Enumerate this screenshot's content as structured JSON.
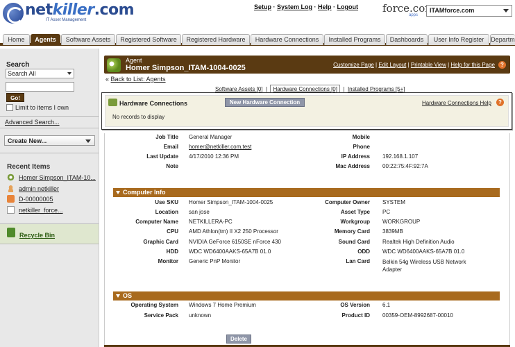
{
  "header": {
    "logo_text_a": "net",
    "logo_text_b": "killer",
    "logo_text_c": ".com",
    "logo_tagline": "IT Asset Management",
    "links": [
      "Setup",
      "System Log",
      "Help",
      "Logout"
    ],
    "force_logo": "force.com",
    "force_apps": "apps",
    "app_selected": "ITAMforce.com"
  },
  "tabs": [
    "Home",
    "Agents",
    "Software Assets",
    "Registered Software",
    "Registered Hardware",
    "Hardware Connections",
    "Installed Programs",
    "Dashboards",
    "User Info Register",
    "Departm"
  ],
  "sidebar": {
    "search_heading": "Search",
    "search_scope": "Search All",
    "search_value": "",
    "go_label": "Go!",
    "limit_label": "Limit to items I own",
    "advanced_label": "Advanced Search...",
    "create_new_label": "Create New...",
    "recent_heading": "Recent Items",
    "recent_items": [
      "Homer Simpson_ITAM-10...",
      "admin netkiller",
      "D-00000005",
      "netkiller_force..."
    ],
    "recycle_label": "Recycle Bin"
  },
  "record": {
    "type_label": "Agent",
    "name": "Homer Simpson_ITAM-1004-0025",
    "header_links": [
      "Customize Page",
      "Edit Layout",
      "Printable View",
      "Help for this Page"
    ],
    "back_link": "Back to List: Agents",
    "subtabs": {
      "software": "Software Assets",
      "software_count": "[0]",
      "hardware": "Hardware Connections",
      "hardware_count": "[0]",
      "installed": "Installed Programs",
      "installed_count": "[5+]"
    }
  },
  "hardware_connections": {
    "title": "Hardware Connections",
    "new_button": "New Hardware Connection",
    "help_link": "Hardware Connections Help",
    "empty_text": "No records to display"
  },
  "details_top": [
    {
      "l1": "Job Title",
      "v1": "General Manager",
      "l2": "Mobile",
      "v2": ""
    },
    {
      "l1": "Email",
      "v1": "homer@netkiller.com.test",
      "l2": "Phone",
      "v2": ""
    },
    {
      "l1": "Last Update",
      "v1": "4/17/2010 12:36 PM",
      "l2": "IP Address",
      "v2": "192.168.1.107"
    },
    {
      "l1": "Note",
      "v1": "",
      "l2": "Mac Address",
      "v2": "00:22:75:4F:92:7A"
    }
  ],
  "computer_info": {
    "title": "Computer Info",
    "rows": [
      {
        "l1": "Use SKU",
        "v1": "Homer Simpson_ITAM-1004-0025",
        "l2": "Computer Owner",
        "v2": "SYSTEM"
      },
      {
        "l1": "Location",
        "v1": "san jose",
        "l2": "Asset Type",
        "v2": "PC"
      },
      {
        "l1": "Computer Name",
        "v1": "NETKILLERA-PC",
        "l2": "Workgroup",
        "v2": "WORKGROUP"
      },
      {
        "l1": "CPU",
        "v1": "AMD Athlon(tm) II X2 250 Processor",
        "l2": "Memory Card",
        "v2": "3839MB"
      },
      {
        "l1": "Graphic Card",
        "v1": "NVIDIA GeForce 6150SE nForce 430",
        "l2": "Sound Card",
        "v2": "Realtek High Definition Audio"
      },
      {
        "l1": "HDD",
        "v1": "WDC WD6400AAKS-65A7B 01.0",
        "l2": "ODD",
        "v2": "WDC WD6400AAKS-65A7B 01.0"
      },
      {
        "l1": "Monitor",
        "v1": "Generic PnP Monitor",
        "l2": "Lan Card",
        "v2": "Belkin 54g Wireless USB Network Adapter"
      }
    ]
  },
  "os": {
    "title": "OS",
    "rows": [
      {
        "l1": "Operating System",
        "v1": "Windows 7 Home Premium",
        "l2": "OS Version",
        "v2": "6.1"
      },
      {
        "l1": "Service Pack",
        "v1": "unknown",
        "l2": "Product ID",
        "v2": "00359-OEM-8992687-00010"
      }
    ]
  },
  "delete_label": "Delete"
}
